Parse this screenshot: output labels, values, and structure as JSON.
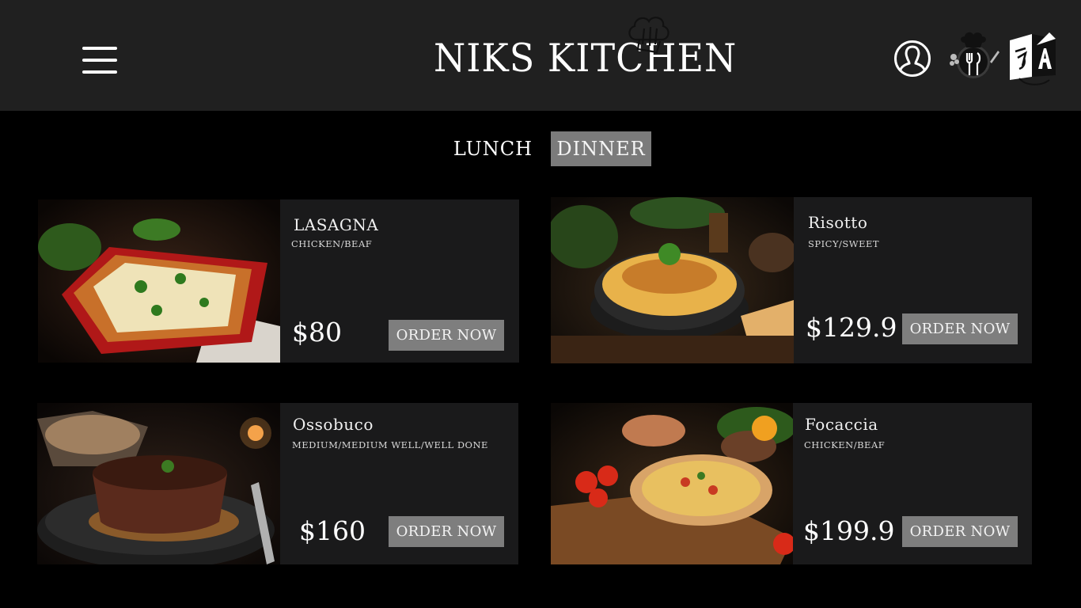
{
  "header": {
    "brand": "NIKS KITCHEN",
    "menu_icon": "hamburger-menu-icon",
    "user_icon": "user-profile-icon",
    "chef_icon": "chef-cutlery-icon",
    "language_icon": "language-translate-icon"
  },
  "tabs": [
    {
      "label": "LUNCH",
      "active": false
    },
    {
      "label": "DINNER",
      "active": true
    }
  ],
  "dishes": [
    {
      "name": "LASAGNA",
      "options": "CHICKEN/BEAF",
      "price": "$80",
      "order_label": "ORDER NOW",
      "image": "lasagna-photo"
    },
    {
      "name": "Risotto",
      "options": "SPICY/SWEET",
      "price": "$129.9",
      "order_label": "ORDER NOW",
      "image": "risotto-photo"
    },
    {
      "name": "Ossobuco",
      "options": "MEDIUM/MEDIUM WELL/WELL DONE",
      "price": "$160",
      "order_label": "ORDER NOW",
      "image": "ossobuco-photo"
    },
    {
      "name": "Focaccia",
      "options": "CHICKEN/BEAF",
      "price": "$199.9",
      "order_label": "ORDER NOW",
      "image": "focaccia-photo"
    }
  ],
  "colors": {
    "page_bg": "#000000",
    "header_bg": "#202020",
    "card_bg": "#1a1a1b",
    "button_bg": "#7e7e7e",
    "active_tab_bg": "#7b7b7b"
  }
}
